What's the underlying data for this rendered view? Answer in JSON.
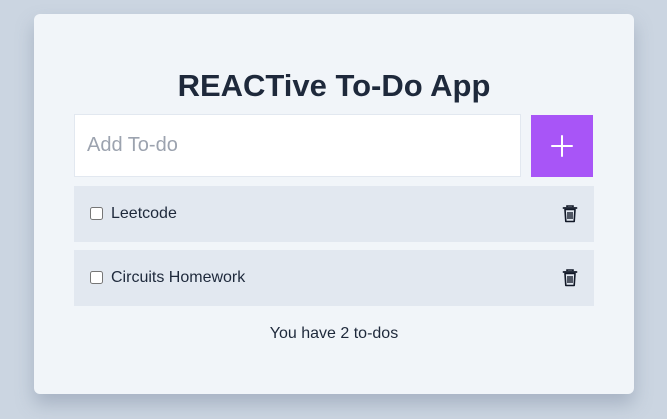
{
  "app": {
    "title": "REACTive To-Do App"
  },
  "input": {
    "placeholder": "Add To-do",
    "value": ""
  },
  "add_button": {
    "icon": "plus-icon"
  },
  "todos": [
    {
      "label": "Leetcode",
      "checked": false
    },
    {
      "label": "Circuits Homework",
      "checked": false
    }
  ],
  "footer": {
    "count_text": "You have 2 to-dos"
  },
  "colors": {
    "background": "#cbd5e1",
    "card": "#f1f5f9",
    "accent": "#a855f7",
    "item": "#e2e8f0",
    "text": "#1e293b"
  }
}
